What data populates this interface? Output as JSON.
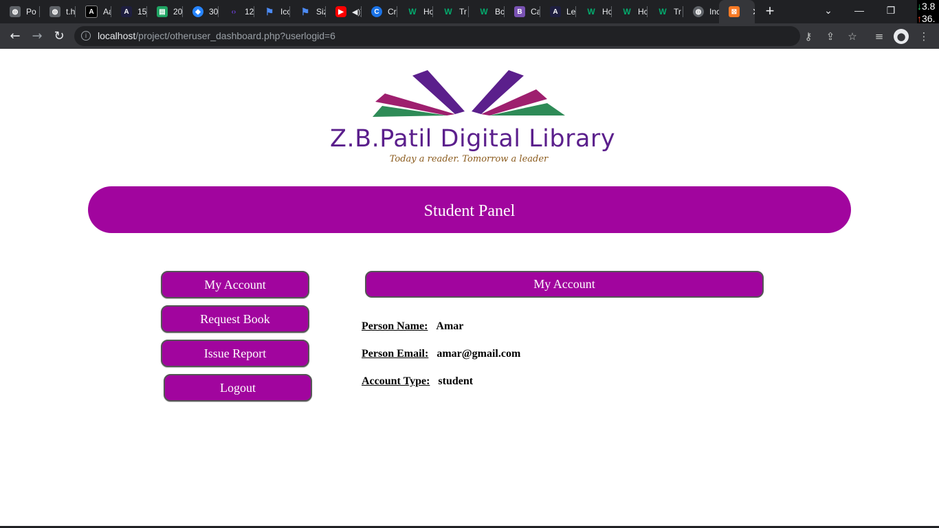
{
  "browser": {
    "tabs": [
      {
        "title": "Po",
        "icon": "globe-icon",
        "color": "#5f6368"
      },
      {
        "title": "t.h",
        "icon": "globe-icon",
        "color": "#5f6368"
      },
      {
        "title": "Aa",
        "icon": "a-logo-icon",
        "color": "#000000"
      },
      {
        "title": "15",
        "icon": "angular-icon",
        "color": "#1e1e3f"
      },
      {
        "title": "20",
        "icon": "sheet-icon",
        "color": "#1fa463"
      },
      {
        "title": "30",
        "icon": "diamond-icon",
        "color": "#2684ff"
      },
      {
        "title": "12",
        "icon": "code-icon",
        "color": "#6b3fd4"
      },
      {
        "title": "Ico",
        "icon": "flag-icon",
        "color": "#4c8bf5"
      },
      {
        "title": "Siz",
        "icon": "flag-icon",
        "color": "#4c8bf5"
      },
      {
        "title": "",
        "icon": "youtube-icon",
        "color": "#ff0000"
      },
      {
        "title": "Cr",
        "icon": "c-icon",
        "color": "#1a73e8"
      },
      {
        "title": "Hc",
        "icon": "w-icon",
        "color": "#04aa6d"
      },
      {
        "title": "Tr",
        "icon": "w-icon",
        "color": "#04aa6d"
      },
      {
        "title": "Bc",
        "icon": "w-icon",
        "color": "#04aa6d"
      },
      {
        "title": "Ca",
        "icon": "bootstrap-icon",
        "color": "#7952b3"
      },
      {
        "title": "Le",
        "icon": "angular-icon",
        "color": "#1e1e3f"
      },
      {
        "title": "Hc",
        "icon": "w-icon",
        "color": "#04aa6d"
      },
      {
        "title": "Hc",
        "icon": "w-icon",
        "color": "#04aa6d"
      },
      {
        "title": "Tr",
        "icon": "w-icon",
        "color": "#04aa6d"
      },
      {
        "title": "Inc",
        "icon": "globe-icon",
        "color": "#5f6368"
      },
      {
        "title": "",
        "icon": "xampp-icon",
        "color": "#fb7a24",
        "active": true
      }
    ],
    "url_host": "localhost",
    "url_path": "/project/otheruser_dashboard.php?userlogid=6",
    "netmon_down": "3.8",
    "netmon_up": "36."
  },
  "logo": {
    "title": "Z.B.Patil Digital Library",
    "tagline": "Today a reader. Tomorrow a leader",
    "colors": {
      "purple": "#5b1f8c",
      "magenta": "#9e1f6e",
      "green": "#2e8b57"
    }
  },
  "banner": {
    "title": "Student Panel"
  },
  "sidebar": {
    "items": [
      {
        "label": "My Account"
      },
      {
        "label": "Request Book"
      },
      {
        "label": "Issue Report"
      },
      {
        "label": "Logout"
      }
    ]
  },
  "main": {
    "section_title": "My Account",
    "fields": [
      {
        "label": "Person Name:",
        "value": "Amar"
      },
      {
        "label": "Person Email:",
        "value": "amar@gmail.com"
      },
      {
        "label": "Account Type:",
        "value": "student"
      }
    ]
  },
  "theme": {
    "accent": "#a1059e"
  }
}
